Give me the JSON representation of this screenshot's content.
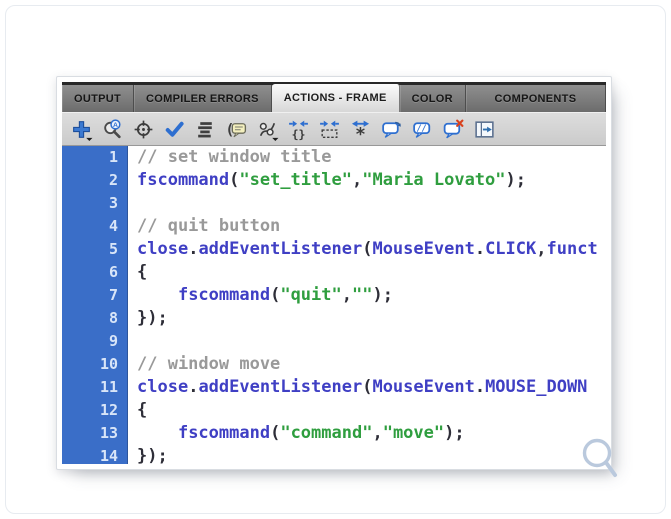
{
  "panel": {
    "tabs": [
      {
        "label": "OUTPUT",
        "active": false
      },
      {
        "label": "COMPILER ERRORS",
        "active": false
      },
      {
        "label": "ACTIONS - FRAME",
        "active": true
      },
      {
        "label": "COLOR",
        "active": false
      },
      {
        "label": "COMPONENTS",
        "active": false
      }
    ],
    "toolbar_icons": [
      {
        "name": "add-script-icon",
        "glyph": "plus",
        "caret": true
      },
      {
        "name": "find-icon",
        "glyph": "find",
        "caret": false
      },
      {
        "name": "insert-target-path-icon",
        "glyph": "target",
        "caret": false
      },
      {
        "name": "check-syntax-icon",
        "glyph": "check",
        "caret": false
      },
      {
        "name": "auto-format-icon",
        "glyph": "format",
        "caret": false
      },
      {
        "name": "show-code-hint-icon",
        "glyph": "hint",
        "caret": false
      },
      {
        "name": "debug-options-icon",
        "glyph": "debug",
        "caret": true
      },
      {
        "name": "collapse-between-braces-icon",
        "glyph": "collapse-braces",
        "caret": false
      },
      {
        "name": "collapse-selection-icon",
        "glyph": "collapse-selection",
        "caret": false
      },
      {
        "name": "expand-all-icon",
        "glyph": "expand-all",
        "caret": false
      },
      {
        "name": "apply-block-comment-icon",
        "glyph": "comment-block",
        "caret": false
      },
      {
        "name": "apply-line-comment-icon",
        "glyph": "comment-line",
        "caret": false
      },
      {
        "name": "remove-comment-icon",
        "glyph": "comment-remove",
        "caret": false
      },
      {
        "name": "show-hide-toolbox-icon",
        "glyph": "toolbox",
        "caret": false
      }
    ],
    "editor": {
      "lines": [
        {
          "num": "1",
          "segments": [
            [
              "cm",
              "// set window title"
            ]
          ]
        },
        {
          "num": "2",
          "segments": [
            [
              "id",
              "fscommand"
            ],
            [
              "pu",
              "("
            ],
            [
              "st",
              "\"set_title\""
            ],
            [
              "pu",
              ","
            ],
            [
              "st",
              "\"Maria Lovato\""
            ],
            [
              "pu",
              ");"
            ]
          ]
        },
        {
          "num": "3",
          "segments": []
        },
        {
          "num": "4",
          "segments": [
            [
              "cm",
              "// quit button"
            ]
          ]
        },
        {
          "num": "5",
          "segments": [
            [
              "id",
              "close"
            ],
            [
              "pu",
              "."
            ],
            [
              "id",
              "addEventListener"
            ],
            [
              "pu",
              "("
            ],
            [
              "id",
              "MouseEvent"
            ],
            [
              "pu",
              "."
            ],
            [
              "id",
              "CLICK"
            ],
            [
              "pu",
              ","
            ],
            [
              "id",
              "funct"
            ]
          ]
        },
        {
          "num": "6",
          "segments": [
            [
              "pu",
              "{"
            ]
          ]
        },
        {
          "num": "7",
          "segments": [
            [
              "pu",
              "    "
            ],
            [
              "id",
              "fscommand"
            ],
            [
              "pu",
              "("
            ],
            [
              "st",
              "\"quit\""
            ],
            [
              "pu",
              ","
            ],
            [
              "st",
              "\"\""
            ],
            [
              "pu",
              ");"
            ]
          ]
        },
        {
          "num": "8",
          "segments": [
            [
              "pu",
              "});"
            ]
          ]
        },
        {
          "num": "9",
          "segments": []
        },
        {
          "num": "10",
          "segments": [
            [
              "cm",
              "// window move"
            ]
          ]
        },
        {
          "num": "11",
          "segments": [
            [
              "id",
              "close"
            ],
            [
              "pu",
              "."
            ],
            [
              "id",
              "addEventListener"
            ],
            [
              "pu",
              "("
            ],
            [
              "id",
              "MouseEvent"
            ],
            [
              "pu",
              "."
            ],
            [
              "id",
              "MOUSE_DOWN"
            ]
          ]
        },
        {
          "num": "12",
          "segments": [
            [
              "pu",
              "{"
            ]
          ]
        },
        {
          "num": "13",
          "segments": [
            [
              "pu",
              "    "
            ],
            [
              "id",
              "fscommand"
            ],
            [
              "pu",
              "("
            ],
            [
              "st",
              "\"command\""
            ],
            [
              "pu",
              ","
            ],
            [
              "st",
              "\"move\""
            ],
            [
              "pu",
              ");"
            ]
          ]
        },
        {
          "num": "14",
          "segments": [
            [
              "pu",
              "});"
            ]
          ]
        }
      ]
    },
    "colors": {
      "gutter": "#3a6ec8",
      "code_identifier": "#3f3fc4",
      "code_string": "#2f9e3f",
      "code_comment": "#999999",
      "code_punctuation": "#2e2e38",
      "accent_blue": "#2e6fd0"
    }
  },
  "watermark": {
    "icon": "magnifier-watermark"
  }
}
